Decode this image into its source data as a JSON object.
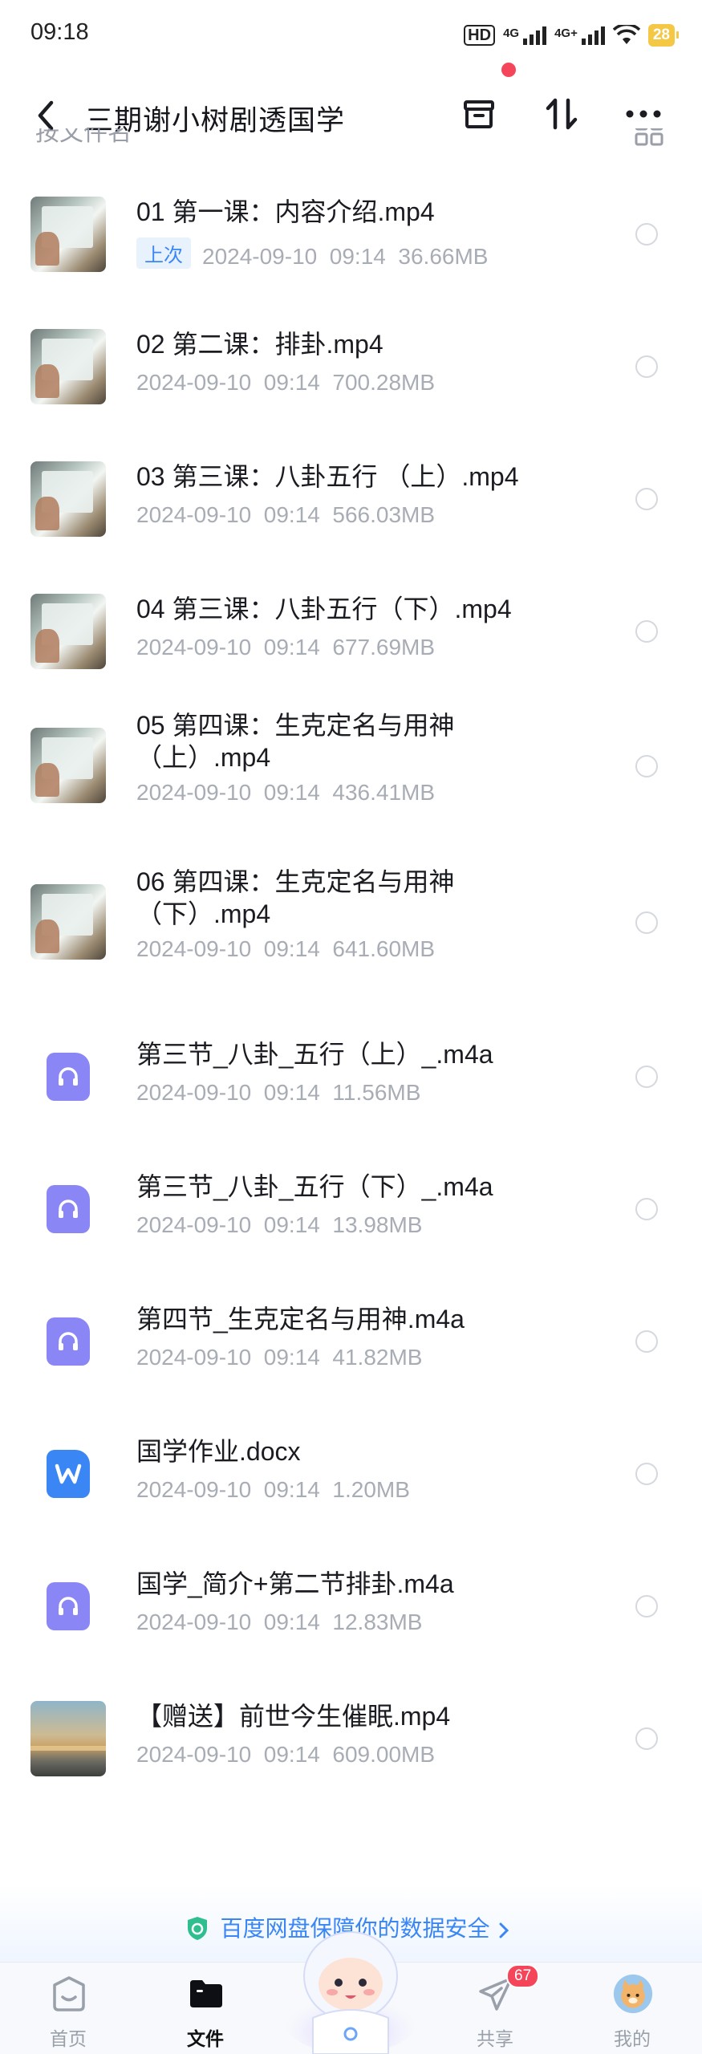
{
  "status_bar": {
    "time": "09:18",
    "hd": "HD",
    "net1": "4G",
    "net2": "4G+",
    "battery": "28"
  },
  "header": {
    "title": "三期谢小树剧透国学",
    "sort_label": "按文件名"
  },
  "files": [
    {
      "name": "01 第一课：内容介绍.mp4",
      "meta": "2024-09-10  09:14  36.66MB",
      "tag": "上次",
      "type": "video"
    },
    {
      "name": "02 第二课：排卦.mp4",
      "meta": "2024-09-10  09:14  700.28MB",
      "type": "video"
    },
    {
      "name": "03 第三课：八卦五行 （上）.mp4",
      "meta": "2024-09-10  09:14  566.03MB",
      "type": "video"
    },
    {
      "name": "04 第三课：八卦五行（下）.mp4",
      "meta": "2024-09-10  09:14  677.69MB",
      "type": "video"
    },
    {
      "name": "05 第四课：生克定名与用神（上）.mp4",
      "meta": "2024-09-10  09:14  436.41MB",
      "type": "video"
    },
    {
      "name": "06 第四课：生克定名与用神（下）.mp4",
      "meta": "2024-09-10  09:14  641.60MB",
      "type": "video"
    },
    {
      "name": "第三节_八卦_五行（上）_.m4a",
      "meta": "2024-09-10  09:14  11.56MB",
      "type": "audio"
    },
    {
      "name": "第三节_八卦_五行（下）_.m4a",
      "meta": "2024-09-10  09:14  13.98MB",
      "type": "audio"
    },
    {
      "name": "第四节_生克定名与用神.m4a",
      "meta": "2024-09-10  09:14  41.82MB",
      "type": "audio"
    },
    {
      "name": "国学作业.docx",
      "meta": "2024-09-10  09:14  1.20MB",
      "type": "word"
    },
    {
      "name": "国学_简介+第二节排卦.m4a",
      "meta": "2024-09-10  09:14  12.83MB",
      "type": "audio"
    },
    {
      "name": "【赠送】前世今生催眠.mp4",
      "meta": "2024-09-10  09:14  609.00MB",
      "type": "sunset"
    }
  ],
  "security_banner": "百度网盘保障你的数据安全",
  "tabs": {
    "home": "首页",
    "files": "文件",
    "share": "共享",
    "share_badge": "67",
    "mine": "我的"
  },
  "colors": {
    "accent": "#3a86f5",
    "audio_icon": "#8b86f5",
    "badge": "#f5455b"
  }
}
